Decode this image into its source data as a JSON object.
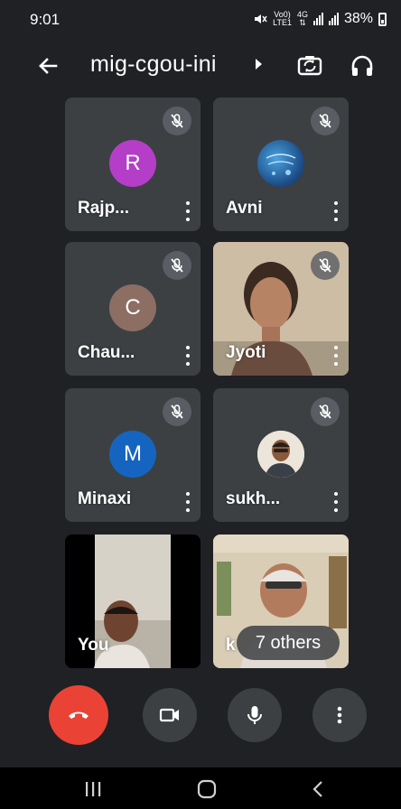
{
  "status_bar": {
    "time": "9:01",
    "network_top": "Vo0)",
    "network_bottom": "LTE1",
    "network_gen": "4G",
    "battery": "38%"
  },
  "header": {
    "title": "mig-cgou-ini",
    "back_icon": "arrow-left-icon",
    "switch_camera_icon": "camera-switch-icon",
    "audio_icon": "headphones-icon"
  },
  "participants": [
    {
      "name": "Rajp...",
      "initial": "R",
      "avatar_color": "#b43ec8",
      "muted": true
    },
    {
      "name": "Avni",
      "initial": "",
      "avatar_color": "#1d4e89",
      "muted": true
    },
    {
      "name": "Chau...",
      "initial": "C",
      "avatar_color": "#8d6e63",
      "muted": true
    },
    {
      "name": "Jyoti",
      "initial": "",
      "avatar_color": "",
      "muted": true
    },
    {
      "name": "Minaxi",
      "initial": "M",
      "avatar_color": "#1565c0",
      "muted": true
    },
    {
      "name": "sukh...",
      "initial": "",
      "avatar_color": "#e8e2d6",
      "muted": true
    },
    {
      "name": "You",
      "initial": "",
      "avatar_color": "",
      "muted": false
    },
    {
      "name": "k",
      "initial": "",
      "avatar_color": "",
      "muted": false
    }
  ],
  "others": {
    "label": "7 others"
  },
  "controls": {
    "end_call_color": "#ea4335",
    "end_call_icon": "phone-hangup-icon",
    "camera_icon": "video-camera-icon",
    "mic_icon": "microphone-icon",
    "more_icon": "more-vertical-icon"
  }
}
